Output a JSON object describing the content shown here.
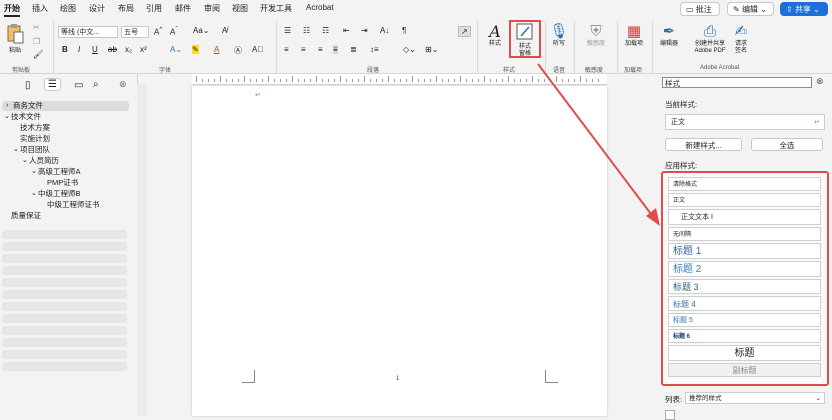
{
  "menu": {
    "tabs": [
      "开始",
      "插入",
      "绘图",
      "设计",
      "布局",
      "引用",
      "邮件",
      "审阅",
      "视图",
      "开发工具",
      "Acrobat"
    ],
    "comment_label": "批注",
    "edit_label": "编辑",
    "share_label": "共享"
  },
  "ribbon": {
    "groups": {
      "clipboard": "剪贴板",
      "font": "字体",
      "paragraph": "段落",
      "styles": "样式",
      "voice": "语音",
      "sensitivity": "敏感度",
      "addins": "加载项",
      "adobe": "Adobe Acrobat"
    },
    "paste_label": "粘贴",
    "font_name": "等线 (中文...",
    "font_size": "五号",
    "styles_label": "样式",
    "styles_pane_label": "样式\n窗格",
    "dictate_label": "听写",
    "sensitivity_label": "敏感度",
    "addins_label": "加载项",
    "editor_label": "编辑器",
    "create_pdf_label": "创建并共享\nAdobe PDF",
    "request_sign_label": "请求\n签名"
  },
  "nav": {
    "items": [
      {
        "label": "商务文件",
        "indent": 0,
        "arrow": "›"
      },
      {
        "label": "技术文件",
        "indent": 0,
        "arrow": "⌄"
      },
      {
        "label": "技术方案",
        "indent": 1,
        "arrow": ""
      },
      {
        "label": "实施计划",
        "indent": 1,
        "arrow": ""
      },
      {
        "label": "项目团队",
        "indent": 1,
        "arrow": "⌄"
      },
      {
        "label": "人员简历",
        "indent": 2,
        "arrow": "⌄"
      },
      {
        "label": "高级工程师A",
        "indent": 3,
        "arrow": "⌄"
      },
      {
        "label": "PMP证书",
        "indent": 4,
        "arrow": ""
      },
      {
        "label": "中级工程师B",
        "indent": 3,
        "arrow": "⌄"
      },
      {
        "label": "中级工程师证书",
        "indent": 4,
        "arrow": ""
      },
      {
        "label": "质量保证",
        "indent": 0,
        "arrow": ""
      }
    ]
  },
  "document": {
    "page_number": "1"
  },
  "styles_pane": {
    "title": "样式",
    "current_style_label": "当前样式:",
    "current_style": "正文",
    "new_style_button": "新建样式...",
    "select_all_button": "全选",
    "apply_style_label": "应用样式:",
    "styles": [
      {
        "name": "清除格式",
        "size": 6,
        "color": "#222",
        "bold": false,
        "align": "left"
      },
      {
        "name": "正文",
        "size": 6,
        "color": "#222",
        "bold": false,
        "align": "left"
      },
      {
        "name": "正文文本 I",
        "size": 7,
        "color": "#222",
        "bold": false,
        "align": "left"
      },
      {
        "name": "无间隔",
        "size": 6,
        "color": "#222",
        "bold": false,
        "align": "left"
      },
      {
        "name": "标题 1",
        "size": 10,
        "color": "#2f5f9f",
        "bold": false,
        "align": "left"
      },
      {
        "name": "标题 2",
        "size": 10,
        "color": "#2f7fbf",
        "bold": false,
        "align": "left"
      },
      {
        "name": "标题 3",
        "size": 9,
        "color": "#2f5f7f",
        "bold": false,
        "align": "left"
      },
      {
        "name": "标题 4",
        "size": 8,
        "color": "#2f6fb0",
        "bold": false,
        "align": "left"
      },
      {
        "name": "标题 5",
        "size": 7,
        "color": "#2f6fb0",
        "bold": false,
        "align": "left"
      },
      {
        "name": "标题 6",
        "size": 6,
        "color": "#1f3f70",
        "bold": true,
        "align": "left"
      },
      {
        "name": "标题",
        "size": 10,
        "color": "#222",
        "bold": false,
        "align": "center"
      },
      {
        "name": "副标题",
        "size": 8,
        "color": "#888",
        "bold": false,
        "align": "center"
      }
    ],
    "list_label": "列表:",
    "list_value": "推荐的样式"
  },
  "colors": {
    "accent_red": "#e24b4b",
    "share_blue": "#1f6fdb"
  }
}
